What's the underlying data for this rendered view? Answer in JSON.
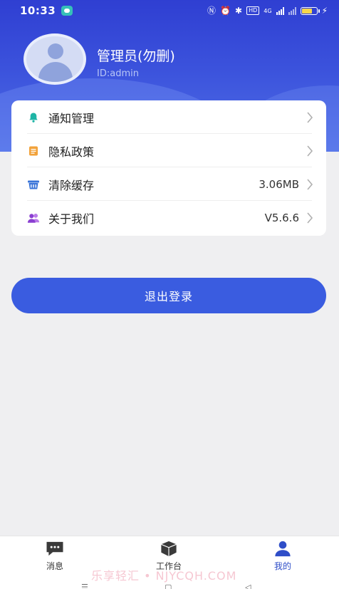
{
  "status_bar": {
    "time": "10:33",
    "hd_badge": "HD",
    "network": "4G"
  },
  "profile": {
    "name": "管理员(勿删)",
    "id": "ID:admin"
  },
  "menu": {
    "items": [
      {
        "label": "通知管理",
        "value": "",
        "icon": "bell-icon",
        "color": "#1fb5a6"
      },
      {
        "label": "隐私政策",
        "value": "",
        "icon": "document-icon",
        "color": "#f2a23a"
      },
      {
        "label": "清除缓存",
        "value": "3.06MB",
        "icon": "trash-basket-icon",
        "color": "#3a74d8"
      },
      {
        "label": "关于我们",
        "value": "V5.6.6",
        "icon": "users-icon",
        "color": "#8a3fd1"
      }
    ]
  },
  "logout": {
    "label": "退出登录"
  },
  "bottom_nav": {
    "tabs": [
      {
        "label": "消息",
        "icon": "chat-bubble-icon"
      },
      {
        "label": "工作台",
        "icon": "box-icon"
      },
      {
        "label": "我的",
        "icon": "user-icon",
        "active": true
      }
    ]
  },
  "watermark": "乐享轻汇 • NJYCQH.COM",
  "colors": {
    "header": "#3b52dc",
    "accent": "#3a5ce0",
    "active_tab": "#2f4ec8"
  }
}
